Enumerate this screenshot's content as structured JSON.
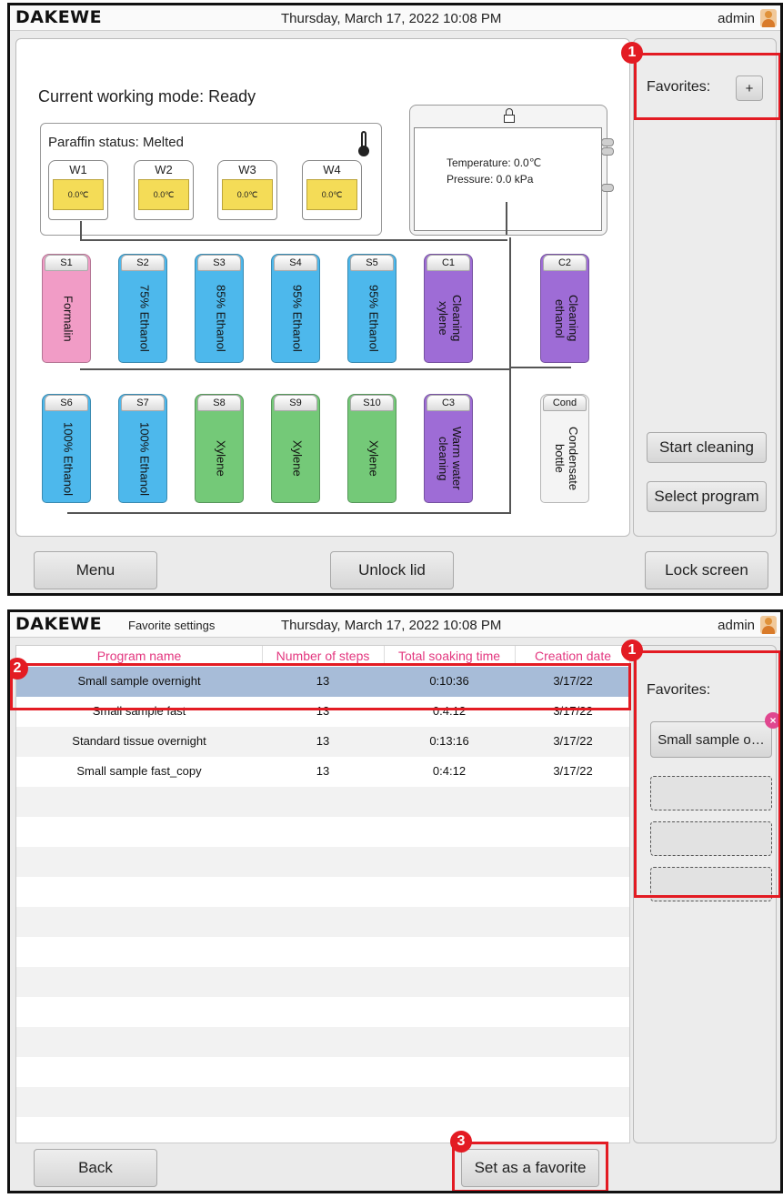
{
  "brand": "DAKEWE",
  "datetime": "Thursday, March 17, 2022  10:08 PM",
  "user": "admin",
  "screen1": {
    "working_mode": "Current working mode:  Ready",
    "paraffin_status": "Paraffin status: Melted",
    "wax_tanks": [
      {
        "label": "W1",
        "temp": "0.0℃"
      },
      {
        "label": "W2",
        "temp": "0.0℃"
      },
      {
        "label": "W3",
        "temp": "0.0℃"
      },
      {
        "label": "W4",
        "temp": "0.0℃"
      }
    ],
    "chamber": {
      "temperature": "Temperature:  0.0℃",
      "pressure": "Pressure:  0.0 kPa"
    },
    "bottles_row1": [
      {
        "cap": "S1",
        "label": "Formalin",
        "color": "#f19cc6"
      },
      {
        "cap": "S2",
        "label": "75% Ethanol",
        "color": "#4db8ec"
      },
      {
        "cap": "S3",
        "label": "85% Ethanol",
        "color": "#4db8ec"
      },
      {
        "cap": "S4",
        "label": "95% Ethanol",
        "color": "#4db8ec"
      },
      {
        "cap": "S5",
        "label": "95% Ethanol",
        "color": "#4db8ec"
      },
      {
        "cap": "C1",
        "label": "Cleaning xylene",
        "color": "#9e6cd6"
      },
      {
        "cap": "C2",
        "label": "Cleaning ethanol",
        "color": "#9e6cd6"
      }
    ],
    "bottles_row2": [
      {
        "cap": "S6",
        "label": "100% Ethanol",
        "color": "#4db8ec"
      },
      {
        "cap": "S7",
        "label": "100% Ethanol",
        "color": "#4db8ec"
      },
      {
        "cap": "S8",
        "label": "Xylene",
        "color": "#74c978"
      },
      {
        "cap": "S9",
        "label": "Xylene",
        "color": "#74c978"
      },
      {
        "cap": "S10",
        "label": "Xylene",
        "color": "#74c978"
      },
      {
        "cap": "C3",
        "label": "Warm water cleaning",
        "color": "#9e6cd6"
      },
      {
        "cap": "Cond",
        "label": "Condensate bottle",
        "color": "#f4f4f4"
      }
    ],
    "favorites_label": "Favorites:",
    "favorites_add": "+",
    "start_cleaning": "Start cleaning",
    "select_program": "Select program",
    "menu": "Menu",
    "unlock_lid": "Unlock lid",
    "lock_screen": "Lock screen",
    "badge": "1"
  },
  "screen2": {
    "subtitle": "Favorite settings",
    "columns": [
      "Program name",
      "Number of steps",
      "Total soaking time",
      "Creation date"
    ],
    "rows": [
      {
        "name": "Small sample overnight",
        "steps": "13",
        "time": "0:10:36",
        "date": "3/17/22"
      },
      {
        "name": "Small sample fast",
        "steps": "13",
        "time": "0:4:12",
        "date": "3/17/22"
      },
      {
        "name": "Standard tissue overnight",
        "steps": "13",
        "time": "0:13:16",
        "date": "3/17/22"
      },
      {
        "name": "Small sample fast_copy",
        "steps": "13",
        "time": "0:4:12",
        "date": "3/17/22"
      }
    ],
    "favorites_label": "Favorites:",
    "favorite_item": "Small sample o…",
    "remove": "×",
    "back": "Back",
    "set_favorite": "Set as a favorite",
    "badges": [
      "1",
      "2",
      "3"
    ]
  }
}
